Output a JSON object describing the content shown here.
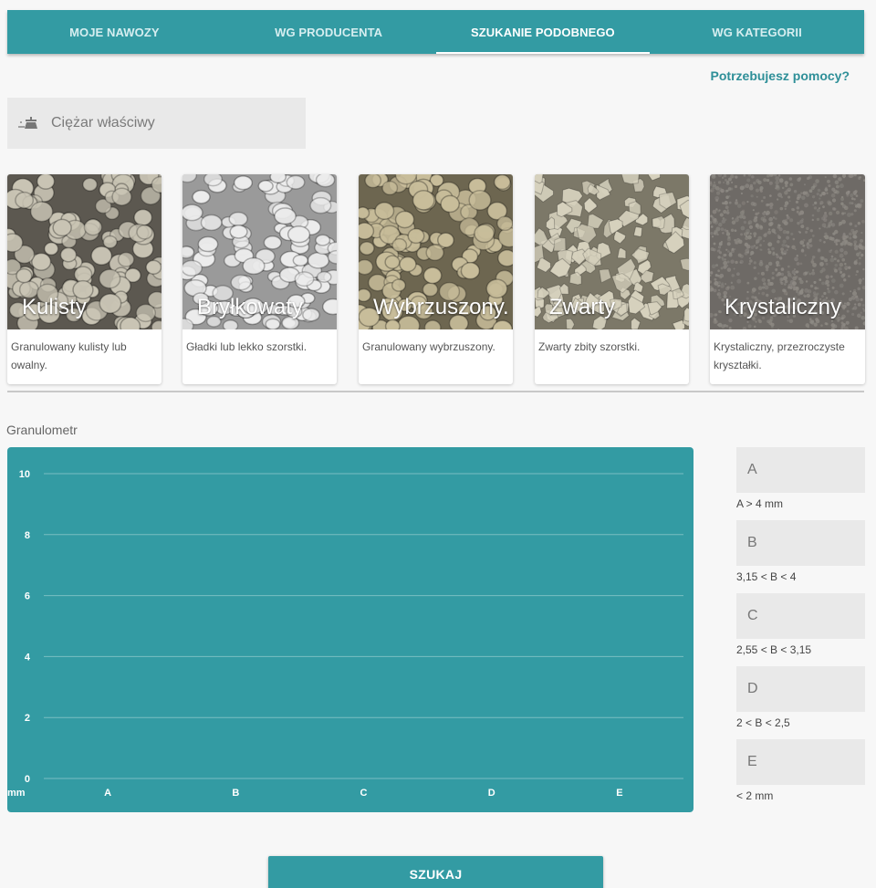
{
  "tabs": [
    {
      "label": "MOJE NAWOZY",
      "active": false
    },
    {
      "label": "WG PRODUCENTA",
      "active": false
    },
    {
      "label": "SZUKANIE PODOBNEGO",
      "active": true
    },
    {
      "label": "WG KATEGORII",
      "active": false
    }
  ],
  "help_link": "Potrzebujesz pomocy?",
  "weight_field": {
    "placeholder": "Ciężar właściwy",
    "value": "",
    "icon": "scale-icon"
  },
  "cards": [
    {
      "title": "Kulisty",
      "description": "Granulowany kulisty lub owalny.",
      "texture": {
        "base": "#5c5850",
        "granule": "#c9c4b4",
        "shape": "round"
      }
    },
    {
      "title": "Bryłkowaty",
      "description": "Gładki lub lekko szorstki.",
      "texture": {
        "base": "#9a9a9a",
        "granule": "#ececec",
        "shape": "pebble"
      }
    },
    {
      "title": "Wybrzuszony.",
      "description": "Granulowany wybrzuszony.",
      "texture": {
        "base": "#6d6650",
        "granule": "#c8bd9a",
        "shape": "round"
      }
    },
    {
      "title": "Zwarty",
      "description": "Zwarty zbity szorstki.",
      "texture": {
        "base": "#7c7868",
        "granule": "#d6d1bd",
        "shape": "angular"
      }
    },
    {
      "title": "Krystaliczny",
      "description": "Krystaliczny, przezroczyste kryształki.",
      "texture": {
        "base": "#6e6a66",
        "granule": "#8e8a84",
        "shape": "fine"
      }
    }
  ],
  "granulometer": {
    "label": "Granulometr",
    "fractions": [
      {
        "name": "A",
        "note": "A > 4 mm",
        "value": ""
      },
      {
        "name": "B",
        "note": "3,15 < B < 4",
        "value": ""
      },
      {
        "name": "C",
        "note": "2,55 < B < 3,15",
        "value": ""
      },
      {
        "name": "D",
        "note": "2 < B < 2,5",
        "value": ""
      },
      {
        "name": "E",
        "note": "< 2 mm",
        "value": ""
      }
    ]
  },
  "chart_data": {
    "type": "bar",
    "categories": [
      "A",
      "B",
      "C",
      "D",
      "E"
    ],
    "values": [
      0,
      0,
      0,
      0,
      0
    ],
    "xlabel": "mm",
    "ylabel": "",
    "ylim": [
      0,
      10
    ],
    "yticks": [
      "0",
      "2",
      "4",
      "6",
      "8",
      "10"
    ],
    "grid": true,
    "background": "#339ba3"
  },
  "search_button": "SZUKAJ",
  "colors": {
    "accent": "#339ba3",
    "link": "#2e8f98",
    "field_bg": "#e9e9e9"
  }
}
